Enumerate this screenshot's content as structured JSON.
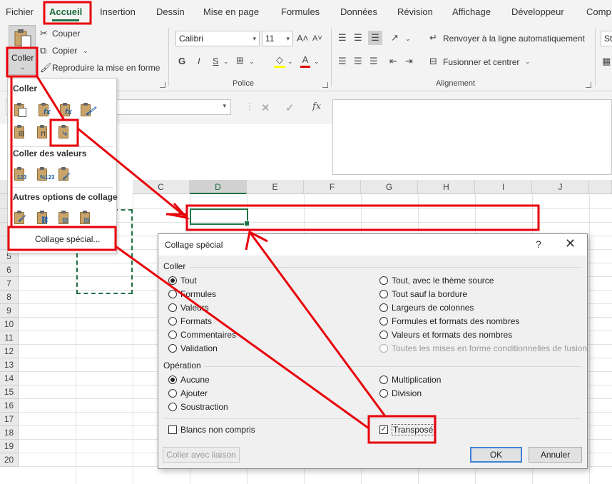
{
  "menu": {
    "tabs": [
      "Fichier",
      "Accueil",
      "Insertion",
      "Dessin",
      "Mise en page",
      "Formules",
      "Données",
      "Révision",
      "Affichage",
      "Développeur",
      "Comp"
    ]
  },
  "ribbon": {
    "clipboard": {
      "paste_label": "Coller",
      "cut_label": "Couper",
      "copy_label": "Copier",
      "format_painter_label": "Reproduire la mise en forme"
    },
    "font": {
      "font_name": "Calibri",
      "font_size": "11",
      "group_label": "Police",
      "bold": "G",
      "italic": "I",
      "underline": "S"
    },
    "alignment": {
      "wrap_text_label": "Renvoyer à la ligne automatiquement",
      "merge_label": "Fusionner et centrer",
      "group_label": "Alignement"
    },
    "styles": {
      "partial_label": "Sta"
    }
  },
  "formula_bar": {
    "fx_label": "fx"
  },
  "grid": {
    "columns": [
      "C",
      "D",
      "E",
      "F",
      "G",
      "H",
      "I",
      "J"
    ],
    "selected_column": "D",
    "rows": [
      "5",
      "6",
      "7",
      "8",
      "9",
      "10",
      "11",
      "12",
      "13",
      "14",
      "15",
      "16",
      "17",
      "18",
      "19",
      "20"
    ]
  },
  "paste_dropdown": {
    "heading_paste": "Coller",
    "heading_values": "Coller des valeurs",
    "heading_other": "Autres options de collage",
    "special_label": "Collage spécial..."
  },
  "dialog": {
    "title": "Collage spécial",
    "help": "?",
    "close": "✕",
    "paste_section": "Coller",
    "paste_options_left": [
      "Tout",
      "Formules",
      "Valeurs",
      "Formats",
      "Commentaires",
      "Validation"
    ],
    "paste_options_right": [
      "Tout, avec le thème source",
      "Tout sauf la bordure",
      "Largeurs de colonnes",
      "Formules et formats des nombres",
      "Valeurs et formats des nombres",
      "Toutes les mises en forme conditionnelles de fusion"
    ],
    "paste_selected": "Tout",
    "operation_section": "Opération",
    "operation_options_left": [
      "Aucune",
      "Ajouter",
      "Soustraction"
    ],
    "operation_options_right": [
      "Multiplication",
      "Division"
    ],
    "operation_selected": "Aucune",
    "skip_blanks_label": "Blancs non compris",
    "transpose_label": "Transposé",
    "transpose_checked": true,
    "paste_link_label": "Coller avec liaison",
    "ok_label": "OK",
    "cancel_label": "Annuler"
  },
  "colors": {
    "excel_green": "#217346",
    "annotation_red": "#e8000b"
  }
}
